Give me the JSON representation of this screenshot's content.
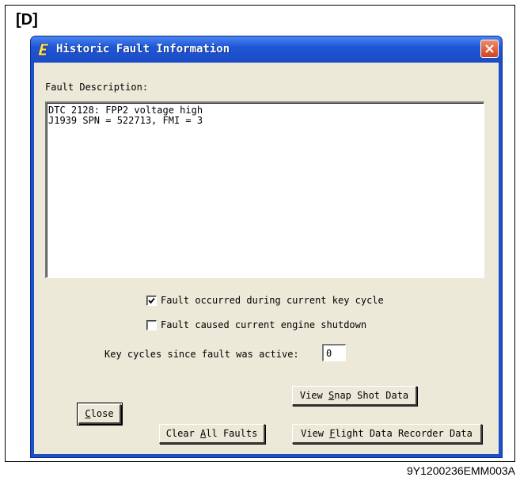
{
  "figure": {
    "section_label": "[D]",
    "caption": "9Y1200236EMM003A"
  },
  "window": {
    "title": "Historic Fault Information",
    "icon": "app-e-icon",
    "close_icon": "close-x-icon",
    "titlebar_color": "#1f56d6",
    "close_color": "#d4421c"
  },
  "fault": {
    "description_label": "Fault Description:",
    "lines": [
      "DTC 2128: FPP2 voltage high",
      "J1939 SPN = 522713, FMI = 3"
    ]
  },
  "checks": {
    "current_key_cycle": {
      "label": "Fault occurred during current key cycle",
      "checked": true
    },
    "engine_shutdown": {
      "label": "Fault caused current engine shutdown",
      "checked": false
    }
  },
  "key_cycles": {
    "label": "Key cycles since fault was active:",
    "value": "0"
  },
  "buttons": {
    "close": {
      "mnemonic": "C",
      "rest": "lose"
    },
    "clear_all": {
      "before": "Clear ",
      "mnemonic": "A",
      "rest": "ll Faults"
    },
    "snap_shot": {
      "before": "View ",
      "mnemonic": "S",
      "rest": "nap Shot Data"
    },
    "flight_data": {
      "before": "View ",
      "mnemonic": "F",
      "rest": "light Data Recorder Data"
    }
  }
}
